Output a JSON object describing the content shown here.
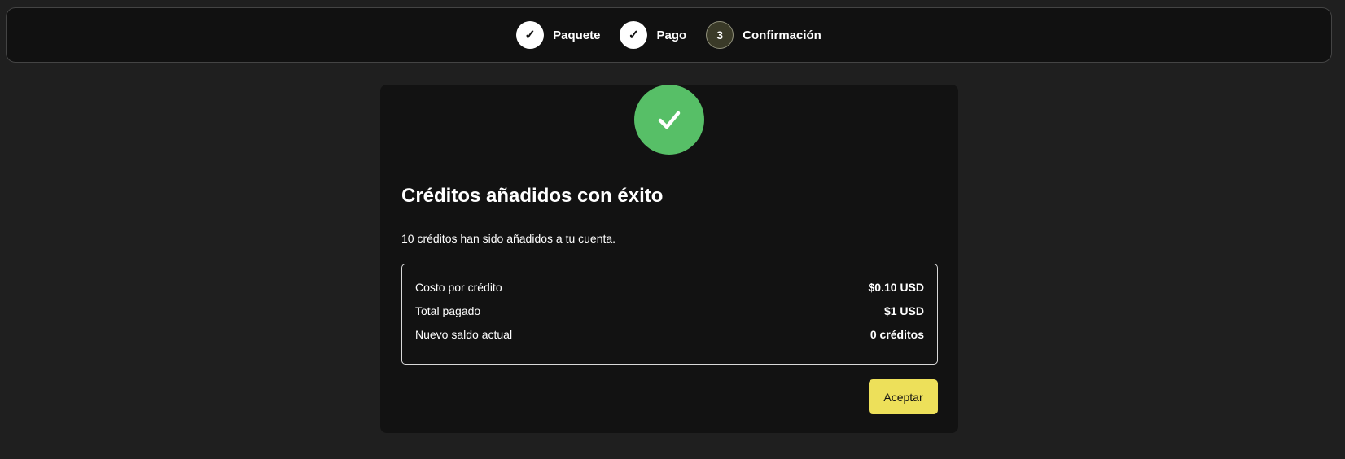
{
  "stepper": {
    "steps": [
      {
        "label": "Paquete",
        "marker": "✓",
        "state": "done"
      },
      {
        "label": "Pago",
        "marker": "✓",
        "state": "done"
      },
      {
        "label": "Confirmación",
        "marker": "3",
        "state": "current"
      }
    ]
  },
  "confirmation": {
    "icon": "checkmark-icon",
    "title": "Créditos añadidos con éxito",
    "message": "10 créditos han sido añadidos a tu cuenta.",
    "summary": [
      {
        "label": "Costo por crédito",
        "value": "$0.10 USD"
      },
      {
        "label": "Total pagado",
        "value": "$1 USD"
      },
      {
        "label": "Nuevo saldo actual",
        "value": "0 créditos"
      }
    ],
    "accept_label": "Aceptar"
  },
  "colors": {
    "success": "#57bf67",
    "accent": "#ede05a",
    "background": "#1f1f1f",
    "card": "#121212"
  }
}
